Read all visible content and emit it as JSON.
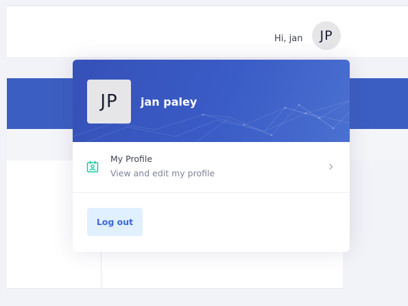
{
  "header": {
    "greeting": "Hi, jan",
    "avatar_initials": "JP"
  },
  "dropdown": {
    "avatar_initials": "JP",
    "user_name": "jan paley",
    "menu_items": [
      {
        "title": "My Profile",
        "subtitle": "View and edit my profile",
        "icon": "profile-card-icon"
      }
    ],
    "logout_label": "Log out"
  },
  "colors": {
    "header_blue": "#3b5ec2",
    "dropdown_header_blue": "#3a5cc6",
    "profile_icon_green": "#1bc5a0",
    "logout_bg": "#e1f0ff",
    "logout_text": "#3969d8"
  }
}
